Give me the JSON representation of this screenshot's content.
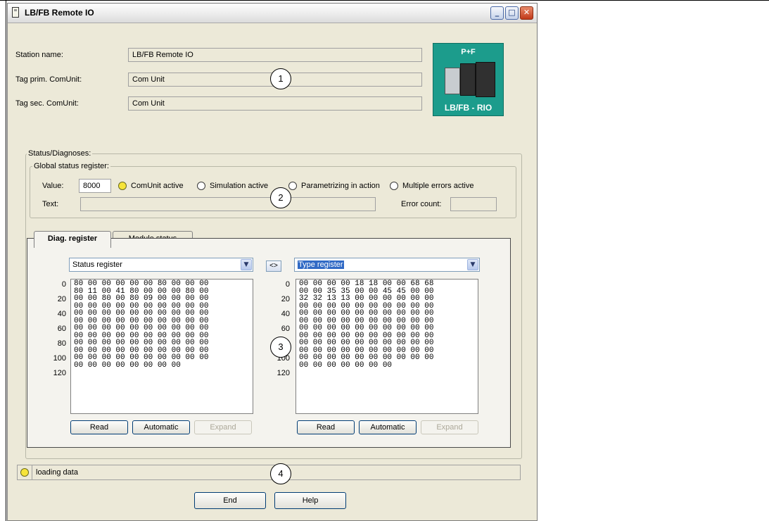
{
  "window": {
    "title": "LB/FB Remote IO"
  },
  "station": {
    "station_name_label": "Station name:",
    "station_name_value": "LB/FB Remote IO",
    "tag_prim_label": "Tag prim. ComUnit:",
    "tag_prim_value": "Com Unit",
    "tag_sec_label": "Tag sec. ComUnit:",
    "tag_sec_value": "Com Unit"
  },
  "logo": {
    "top_text": "P+F",
    "bottom_text": "LB/FB - RIO"
  },
  "callouts": {
    "c1": "1",
    "c2": "2",
    "c3": "3",
    "c4": "4"
  },
  "status_diag": {
    "title": "Status/Diagnoses:",
    "global_title": "Global status register:",
    "value_label": "Value:",
    "value": "8000",
    "radios": [
      {
        "label": "ComUnit active",
        "checked": true
      },
      {
        "label": "Simulation active",
        "checked": false
      },
      {
        "label": "Parametrizing in action",
        "checked": false
      },
      {
        "label": "Multiple errors active",
        "checked": false
      }
    ],
    "text_label": "Text:",
    "text_value": "",
    "error_count_label": "Error count:",
    "error_count_value": ""
  },
  "tabs": [
    {
      "label": "Diag. register",
      "active": true
    },
    {
      "label": "Module status",
      "active": false
    }
  ],
  "left_panel": {
    "selected": "Status register",
    "row_labels": [
      "0",
      "20",
      "40",
      "60",
      "80",
      "100",
      "120"
    ],
    "hex_lines": [
      "80 00 00 00 00 00 80 00 00 00",
      "80 11 00 41 80 00 00 00 80 00",
      "00 00 80 00 80 09 00 00 00 00",
      "00 00 00 00 00 00 00 00 00 00",
      "00 00 00 00 00 00 00 00 00 00",
      "00 00 00 00 00 00 00 00 00 00",
      "00 00 00 00 00 00 00 00 00 00",
      "00 00 00 00 00 00 00 00 00 00",
      "00 00 00 00 00 00 00 00 00 00",
      "00 00 00 00 00 00 00 00 00 00",
      "00 00 00 00 00 00 00 00 00 00",
      "00 00 00 00 00 00 00 00"
    ],
    "read": "Read",
    "automatic": "Automatic",
    "expand": "Expand"
  },
  "swap_label": "<>",
  "right_panel": {
    "selected": "Type register",
    "row_labels": [
      "0",
      "20",
      "40",
      "60",
      "80",
      "100",
      "120"
    ],
    "hex_lines": [
      "00 00 00 00 18 18 00 00 68 68",
      "00 00 35 35 00 00 45 45 00 00",
      "32 32 13 13 00 00 00 00 00 00",
      "00 00 00 00 00 00 00 00 00 00",
      "00 00 00 00 00 00 00 00 00 00",
      "00 00 00 00 00 00 00 00 00 00",
      "00 00 00 00 00 00 00 00 00 00",
      "00 00 00 00 00 00 00 00 00 00",
      "00 00 00 00 00 00 00 00 00 00",
      "00 00 00 00 00 00 00 00 00 00",
      "00 00 00 00 00 00 00 00 00 00",
      "00 00 00 00 00 00 00"
    ],
    "read": "Read",
    "automatic": "Automatic",
    "expand": "Expand"
  },
  "statusbar": {
    "text": "loading data"
  },
  "footer": {
    "end": "End",
    "help": "Help"
  },
  "colors": {
    "led_active": "#f6e43a",
    "logo_bg": "#1c9c8c"
  }
}
